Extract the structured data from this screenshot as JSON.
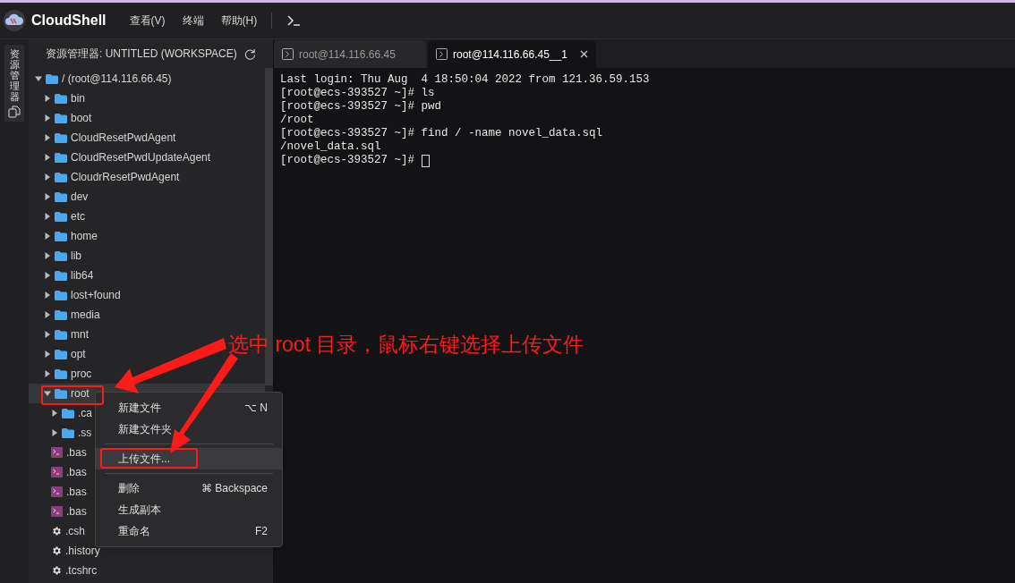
{
  "app": {
    "title": "CloudShell",
    "menu": [
      "查看(V)",
      "终端",
      "帮助(H)"
    ]
  },
  "activity_bar": {
    "label": "资源管理器"
  },
  "explorer": {
    "title": "资源管理器: UNTITLED (WORKSPACE)",
    "tree": [
      {
        "label": "/ (root@114.116.66.45)",
        "kind": "folder",
        "expanded": true,
        "selected": false,
        "children": [
          {
            "label": "bin",
            "kind": "folder",
            "expanded": false,
            "selected": false
          },
          {
            "label": "boot",
            "kind": "folder",
            "expanded": false,
            "selected": false
          },
          {
            "label": "CloudResetPwdAgent",
            "kind": "folder",
            "expanded": false,
            "selected": false
          },
          {
            "label": "CloudResetPwdUpdateAgent",
            "kind": "folder",
            "expanded": false,
            "selected": false
          },
          {
            "label": "CloudrResetPwdAgent",
            "kind": "folder",
            "expanded": false,
            "selected": false
          },
          {
            "label": "dev",
            "kind": "folder",
            "expanded": false,
            "selected": false
          },
          {
            "label": "etc",
            "kind": "folder",
            "expanded": false,
            "selected": false
          },
          {
            "label": "home",
            "kind": "folder",
            "expanded": false,
            "selected": false
          },
          {
            "label": "lib",
            "kind": "folder",
            "expanded": false,
            "selected": false
          },
          {
            "label": "lib64",
            "kind": "folder",
            "expanded": false,
            "selected": false
          },
          {
            "label": "lost+found",
            "kind": "folder",
            "expanded": false,
            "selected": false
          },
          {
            "label": "media",
            "kind": "folder",
            "expanded": false,
            "selected": false
          },
          {
            "label": "mnt",
            "kind": "folder",
            "expanded": false,
            "selected": false
          },
          {
            "label": "opt",
            "kind": "folder",
            "expanded": false,
            "selected": false
          },
          {
            "label": "proc",
            "kind": "folder",
            "expanded": false,
            "selected": false
          },
          {
            "label": "root",
            "kind": "folder",
            "expanded": true,
            "selected": true,
            "children": [
              {
                "label": ".ca",
                "kind": "folder",
                "expanded": false,
                "selected": false
              },
              {
                "label": ".ss",
                "kind": "folder",
                "expanded": false,
                "selected": false
              },
              {
                "label": ".bas",
                "kind": "shell",
                "selected": false
              },
              {
                "label": ".bas",
                "kind": "shell",
                "selected": false
              },
              {
                "label": ".bas",
                "kind": "shell",
                "selected": false
              },
              {
                "label": ".bas",
                "kind": "shell",
                "selected": false
              },
              {
                "label": ".csh",
                "kind": "config",
                "selected": false
              },
              {
                "label": ".history",
                "kind": "config",
                "selected": false
              },
              {
                "label": ".tcshrc",
                "kind": "config",
                "selected": false
              }
            ]
          }
        ]
      }
    ]
  },
  "terminal": {
    "tabs": [
      {
        "label": "root@114.116.66.45",
        "selected": false
      },
      {
        "label": "root@114.116.66.45__1",
        "selected": true
      }
    ],
    "lines": [
      "Last login: Thu Aug  4 18:50:04 2022 from 121.36.59.153",
      "[root@ecs-393527 ~]# ls",
      "[root@ecs-393527 ~]# pwd",
      "/root",
      "[root@ecs-393527 ~]# find / -name novel_data.sql",
      "/novel_data.sql",
      "[root@ecs-393527 ~]# "
    ]
  },
  "context_menu": {
    "items": [
      {
        "kind": "item",
        "label": "新建文件",
        "shortcut": "⌥ N",
        "highlighted": false
      },
      {
        "kind": "item",
        "label": "新建文件夹",
        "highlighted": false
      },
      {
        "kind": "divider"
      },
      {
        "kind": "item",
        "label": "上传文件...",
        "highlighted": true
      },
      {
        "kind": "divider"
      },
      {
        "kind": "item",
        "label": "删除",
        "shortcut": "⌘ Backspace",
        "highlighted": false
      },
      {
        "kind": "item",
        "label": "生成副本",
        "highlighted": false
      },
      {
        "kind": "item",
        "label": "重命名",
        "shortcut": "F2",
        "highlighted": false
      }
    ]
  },
  "annotation": {
    "text": "选中 root 目录，鼠标右键选择上传文件"
  }
}
